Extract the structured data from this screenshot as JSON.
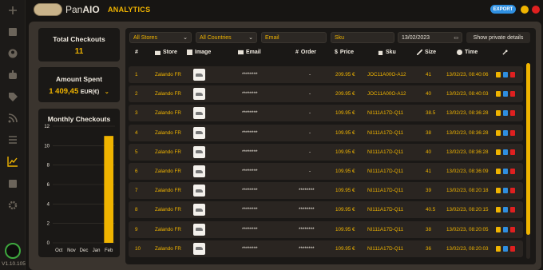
{
  "app": {
    "brand_light": "Pan",
    "brand_bold": "AIO",
    "section": "ANALYTICS",
    "export_label": "EXPORT",
    "version": "V1.10.105"
  },
  "colors": {
    "accent": "#f0b400",
    "export": "#2f8fe0",
    "minimize": "#f0b400",
    "close": "#e02020",
    "bar": "#f0b400",
    "card": "#1a1816",
    "row": "#2a2521"
  },
  "sidebar": {
    "icons": [
      "plus-icon",
      "box-icon",
      "user-icon",
      "robot-icon",
      "tag-icon",
      "rss-icon",
      "list-icon",
      "analytics-icon",
      "image-icon",
      "settings-icon"
    ],
    "active": "analytics-icon"
  },
  "stats": {
    "total_checkouts": {
      "label": "Total Checkouts",
      "value": "11"
    },
    "amount_spent": {
      "label": "Amount Spent",
      "value": "1 409,45",
      "currency": "EUR(€)"
    }
  },
  "filters": {
    "store": "All Stores",
    "country": "All Countries",
    "email_placeholder": "Email",
    "sku_placeholder": "Sku",
    "date": "13/02/2023",
    "private_button": "Show private details"
  },
  "table": {
    "headers": {
      "num": "#",
      "store": "Store",
      "image": "Image",
      "email": "Email",
      "order": "Order",
      "price": "Price",
      "sku": "Sku",
      "size": "Size",
      "time": "Time"
    },
    "rows": [
      {
        "num": "1",
        "store": "Zalando FR",
        "email": "********",
        "order": "-",
        "price": "209.95 €",
        "sku": "JOC11A00O-A12",
        "size": "41",
        "time": "13/02/23, 08:40:06"
      },
      {
        "num": "2",
        "store": "Zalando FR",
        "email": "********",
        "order": "-",
        "price": "209.95 €",
        "sku": "JOC11A00O-A12",
        "size": "40",
        "time": "13/02/23, 08:40:03"
      },
      {
        "num": "3",
        "store": "Zalando FR",
        "email": "********",
        "order": "-",
        "price": "109.95 €",
        "sku": "NI111A17D-Q11",
        "size": "38.5",
        "time": "13/02/23, 08:36:28"
      },
      {
        "num": "4",
        "store": "Zalando FR",
        "email": "********",
        "order": "-",
        "price": "109.95 €",
        "sku": "NI111A17D-Q11",
        "size": "38",
        "time": "13/02/23, 08:36:28"
      },
      {
        "num": "5",
        "store": "Zalando FR",
        "email": "********",
        "order": "-",
        "price": "109.95 €",
        "sku": "NI111A17D-Q11",
        "size": "40",
        "time": "13/02/23, 08:36:28"
      },
      {
        "num": "6",
        "store": "Zalando FR",
        "email": "********",
        "order": "-",
        "price": "109.95 €",
        "sku": "NI111A17D-Q11",
        "size": "41",
        "time": "13/02/23, 08:36:09"
      },
      {
        "num": "7",
        "store": "Zalando FR",
        "email": "********",
        "order": "********",
        "price": "109.95 €",
        "sku": "NI111A17D-Q11",
        "size": "39",
        "time": "13/02/23, 08:20:18"
      },
      {
        "num": "8",
        "store": "Zalando FR",
        "email": "********",
        "order": "********",
        "price": "109.95 €",
        "sku": "NI111A17D-Q11",
        "size": "40.5",
        "time": "13/02/23, 08:20:15"
      },
      {
        "num": "9",
        "store": "Zalando FR",
        "email": "********",
        "order": "********",
        "price": "109.95 €",
        "sku": "NI111A17D-Q11",
        "size": "38",
        "time": "13/02/23, 08:20:05"
      },
      {
        "num": "10",
        "store": "Zalando FR",
        "email": "********",
        "order": "********",
        "price": "109.95 €",
        "sku": "NI111A17D-Q11",
        "size": "36",
        "time": "13/02/23, 08:20:03"
      }
    ]
  },
  "chart_data": {
    "type": "bar",
    "title": "Monthly Checkouts",
    "categories": [
      "Oct",
      "Nov",
      "Dec",
      "Jan",
      "Feb"
    ],
    "values": [
      0,
      0,
      0,
      0,
      11
    ],
    "ylim": [
      0,
      12
    ],
    "yticks": [
      "0",
      "2",
      "4",
      "6",
      "8",
      "10",
      "12"
    ],
    "grid": true
  }
}
